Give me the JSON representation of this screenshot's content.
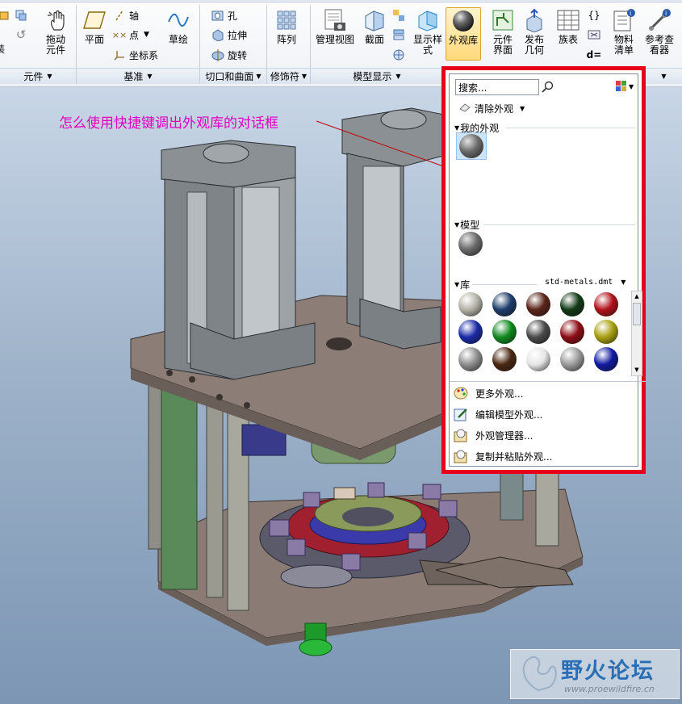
{
  "ribbon": {
    "buttons": {
      "drag": "拖动\n元件",
      "plane": "平面",
      "axis": "轴",
      "point": "点",
      "csys": "坐标系",
      "sketch": "草绘",
      "hole": "孔",
      "extrude": "拉伸",
      "revolve": "旋转",
      "pattern": "阵列",
      "manage_views": "管理视图",
      "section": "截面",
      "display_style": "显示样\n式",
      "appearance_gallery": "外观库",
      "component_interface": "元件\n界面",
      "publish_geometry": "发布\n几何",
      "family_table": "族表",
      "bom": "物料\n清单",
      "ref_viewer": "参考查\n看器",
      "left_cut": "装"
    },
    "groups": {
      "component": "元件",
      "datum": "基准",
      "cut_surface": "切口和曲面",
      "modifiers": "修饰符",
      "model_display": "模型显示"
    }
  },
  "annotation": "怎么使用快捷键调出外观库的对话框",
  "gallery": {
    "search_placeholder": "搜索...",
    "clear_appearance": "清除外观",
    "my_appearances": "我的外观",
    "model": "模型",
    "library": "库",
    "library_file": "std-metals.dmt",
    "commands": [
      "更多外观...",
      "编辑模型外观...",
      "外观管理器...",
      "复制并粘贴外观..."
    ],
    "library_colors": [
      "#b5b2a8",
      "#1d3d6b",
      "#5a2418",
      "#123a16",
      "#b0121a",
      "#1a2aa8",
      "#108a1e",
      "#4a4a4a",
      "#8c0c14",
      "#a8a010",
      "#8e8e8e",
      "#4a2812",
      "#e6e6e6",
      "#9a9a9a",
      "#101aa0"
    ]
  },
  "watermark": {
    "title": "野火论坛",
    "url": "www.proewildfire.cn"
  }
}
